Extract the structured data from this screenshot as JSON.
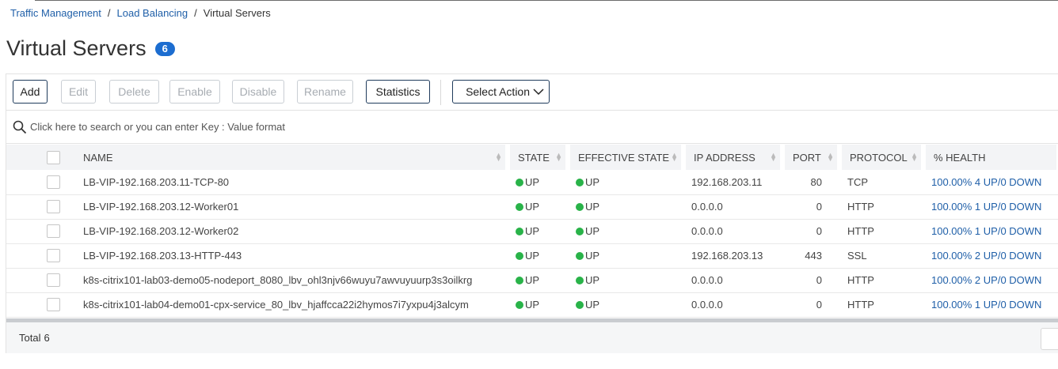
{
  "breadcrumb": {
    "items": [
      "Traffic Management",
      "Load Balancing",
      "Virtual Servers"
    ],
    "separator": "/"
  },
  "page": {
    "title": "Virtual Servers",
    "count": "6"
  },
  "toolbar": {
    "add": "Add",
    "edit": "Edit",
    "delete": "Delete",
    "enable": "Enable",
    "disable": "Disable",
    "rename": "Rename",
    "statistics": "Statistics",
    "select_action": "Select Action"
  },
  "search": {
    "placeholder": "Click here to search or you can enter Key : Value format"
  },
  "table": {
    "columns": {
      "name": "NAME",
      "state": "STATE",
      "effective_state": "EFFECTIVE STATE",
      "ip_address": "IP ADDRESS",
      "port": "PORT",
      "protocol": "PROTOCOL",
      "health": "% HEALTH"
    },
    "rows": [
      {
        "name": "LB-VIP-192.168.203.11-TCP-80",
        "state": "UP",
        "effective_state": "UP",
        "ip": "192.168.203.11",
        "port": "80",
        "protocol": "TCP",
        "health": "100.00% 4 UP/0 DOWN"
      },
      {
        "name": "LB-VIP-192.168.203.12-Worker01",
        "state": "UP",
        "effective_state": "UP",
        "ip": "0.0.0.0",
        "port": "0",
        "protocol": "HTTP",
        "health": "100.00% 1 UP/0 DOWN"
      },
      {
        "name": "LB-VIP-192.168.203.12-Worker02",
        "state": "UP",
        "effective_state": "UP",
        "ip": "0.0.0.0",
        "port": "0",
        "protocol": "HTTP",
        "health": "100.00% 1 UP/0 DOWN"
      },
      {
        "name": "LB-VIP-192.168.203.13-HTTP-443",
        "state": "UP",
        "effective_state": "UP",
        "ip": "192.168.203.13",
        "port": "443",
        "protocol": "SSL",
        "health": "100.00% 2 UP/0 DOWN"
      },
      {
        "name": "k8s-citrix101-lab03-demo05-nodeport_8080_lbv_ohl3njv66wuyu7awvuyuurp3s3oilkrg",
        "state": "UP",
        "effective_state": "UP",
        "ip": "0.0.0.0",
        "port": "0",
        "protocol": "HTTP",
        "health": "100.00% 2 UP/0 DOWN"
      },
      {
        "name": "k8s-citrix101-lab04-demo01-cpx-service_80_lbv_hjaffcca22i2hymos7i7yxpu4j3alcym",
        "state": "UP",
        "effective_state": "UP",
        "ip": "0.0.0.0",
        "port": "0",
        "protocol": "HTTP",
        "health": "100.00% 1 UP/0 DOWN"
      }
    ]
  },
  "footer": {
    "total_label": "Total",
    "total_value": "6"
  },
  "colors": {
    "link": "#1f5fa8",
    "badge": "#1c6dd0",
    "status_up": "#29b349"
  }
}
